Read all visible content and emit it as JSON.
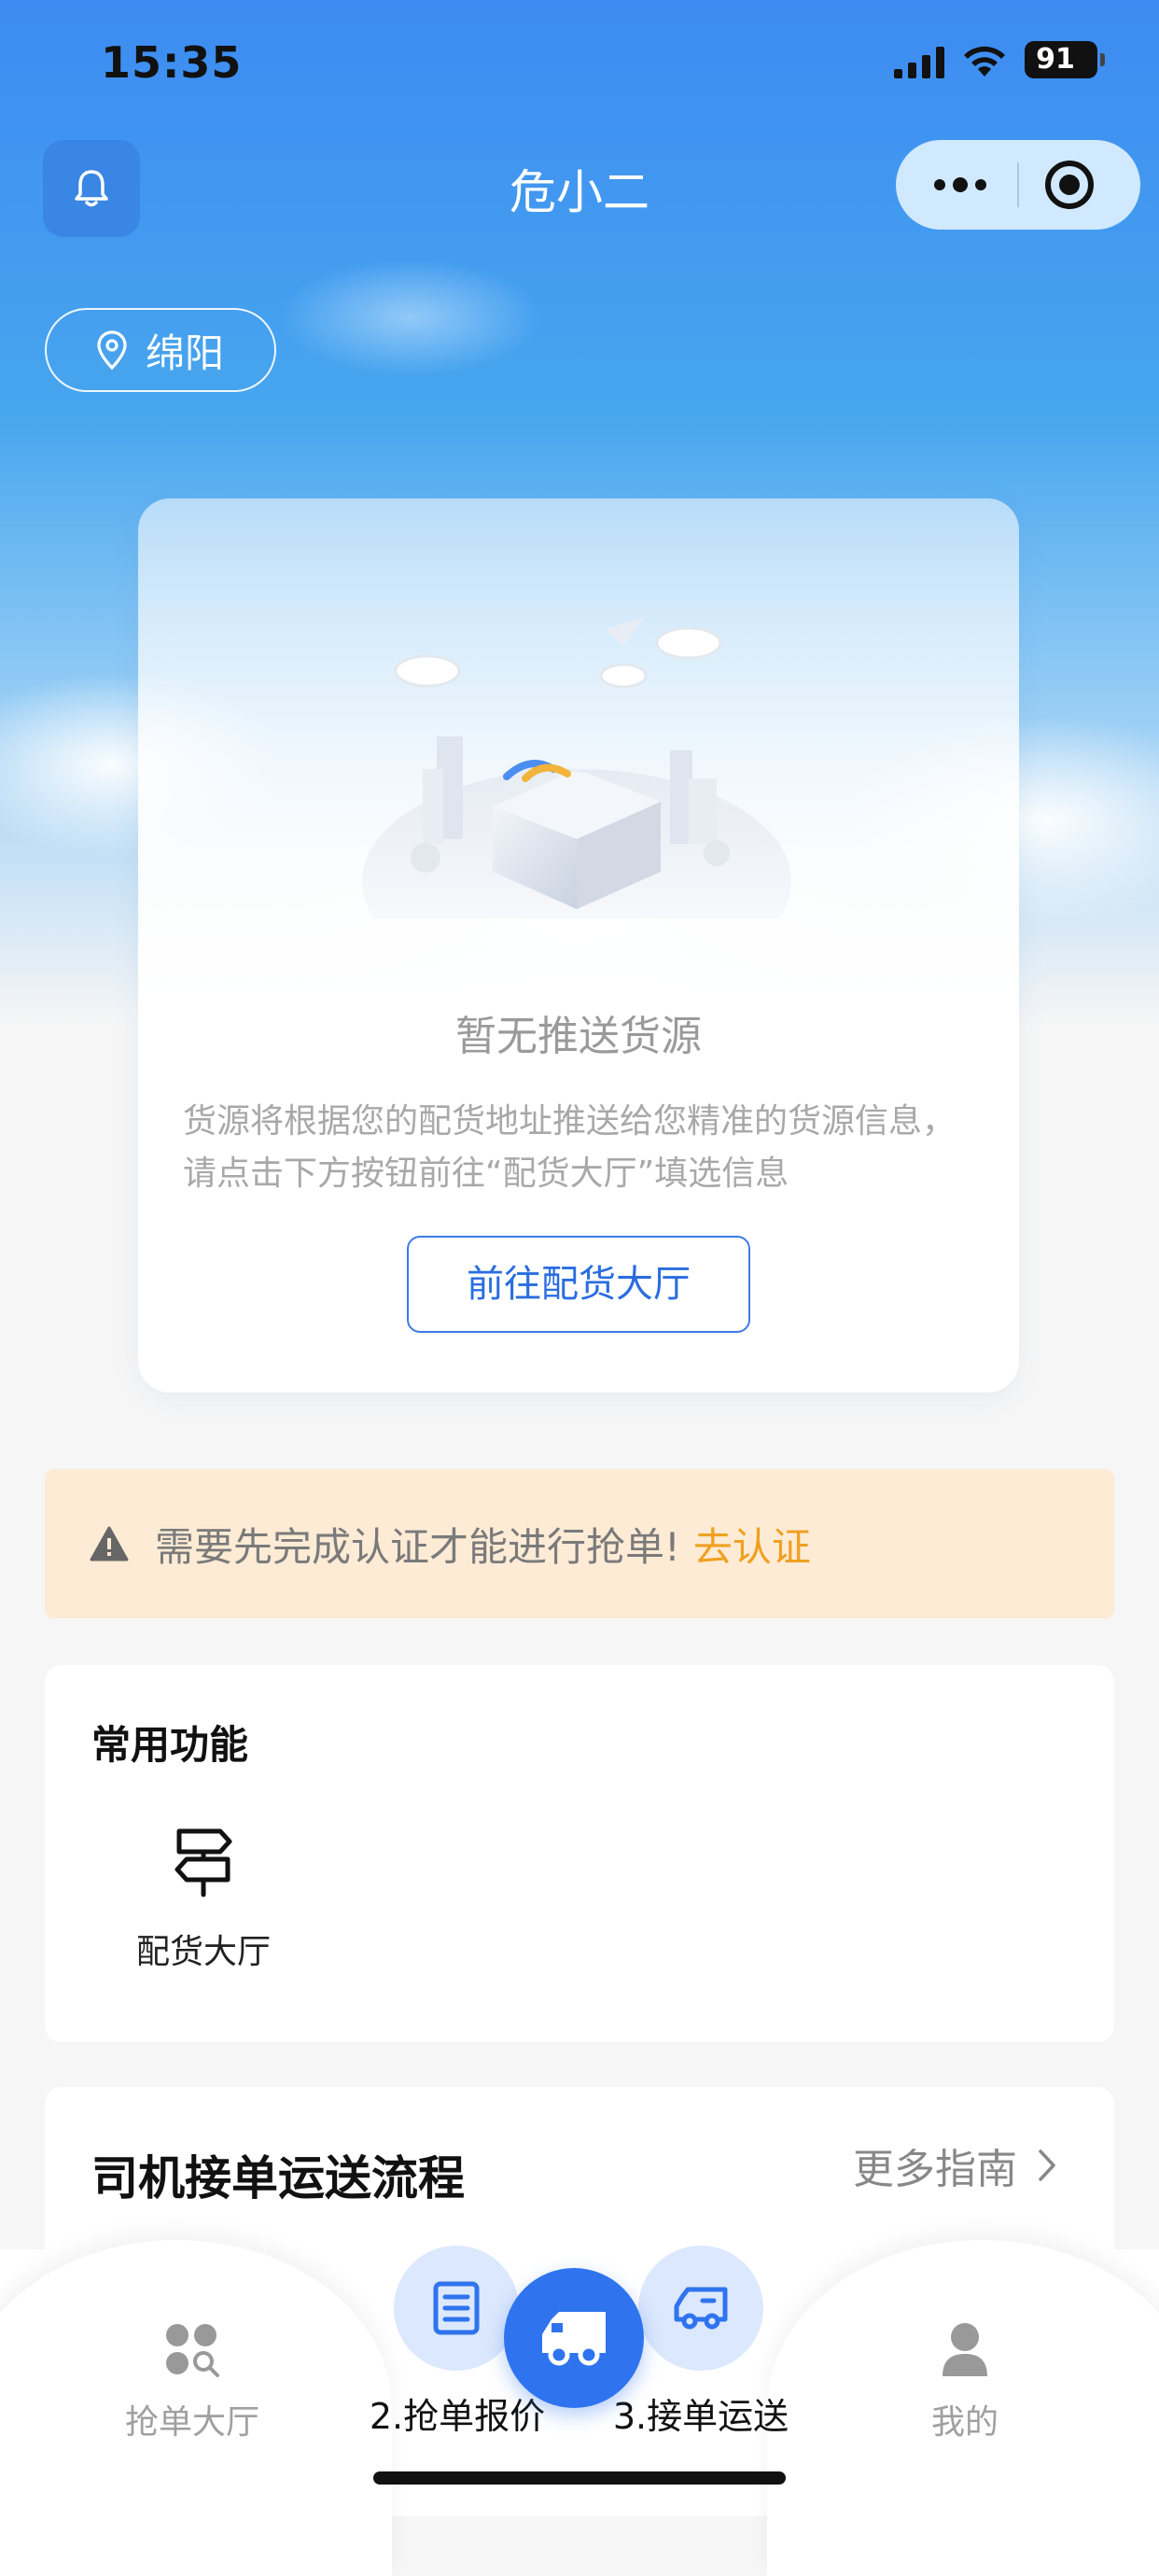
{
  "status_bar": {
    "time": "15:35",
    "battery": "91",
    "icons": [
      "signal-icon",
      "wifi-icon",
      "battery-icon"
    ]
  },
  "nav": {
    "title": "危小二",
    "left_icon": "bell-icon",
    "capsule_icons": [
      "more-dots-icon",
      "close-target-icon"
    ]
  },
  "location": {
    "icon": "location-pin-icon",
    "city": "绵阳"
  },
  "empty_card": {
    "illustration": "empty-box-city-illustration",
    "title": "暂无推送货源",
    "description": "货源将根据您的配货地址推送给您精准的货源信息，请点击下方按钮前往“配货大厅”填选信息",
    "button": "前往配货大厅"
  },
  "notice": {
    "icon": "warning-icon",
    "text": "需要先完成认证才能进行抢单!",
    "link": "去认证"
  },
  "common_functions": {
    "title": "常用功能",
    "items": [
      {
        "icon": "signpost-icon",
        "label": "配货大厅"
      }
    ]
  },
  "flow": {
    "title": "司机接单运送流程",
    "more": "更多指南"
  },
  "tabbar": {
    "left": {
      "icon": "grid-search-icon",
      "label": "抢单大厅"
    },
    "step2": {
      "icon": "document-icon",
      "label": "2.抢单报价"
    },
    "center": {
      "icon": "truck-icon"
    },
    "step3": {
      "icon": "truck-outline-icon",
      "label": "3.接单运送"
    },
    "right": {
      "icon": "user-icon",
      "label": "我的"
    }
  },
  "colors": {
    "accent": "#2f74ee",
    "warning_text": "#f0a020",
    "notice_bg": "#fdebd5"
  }
}
